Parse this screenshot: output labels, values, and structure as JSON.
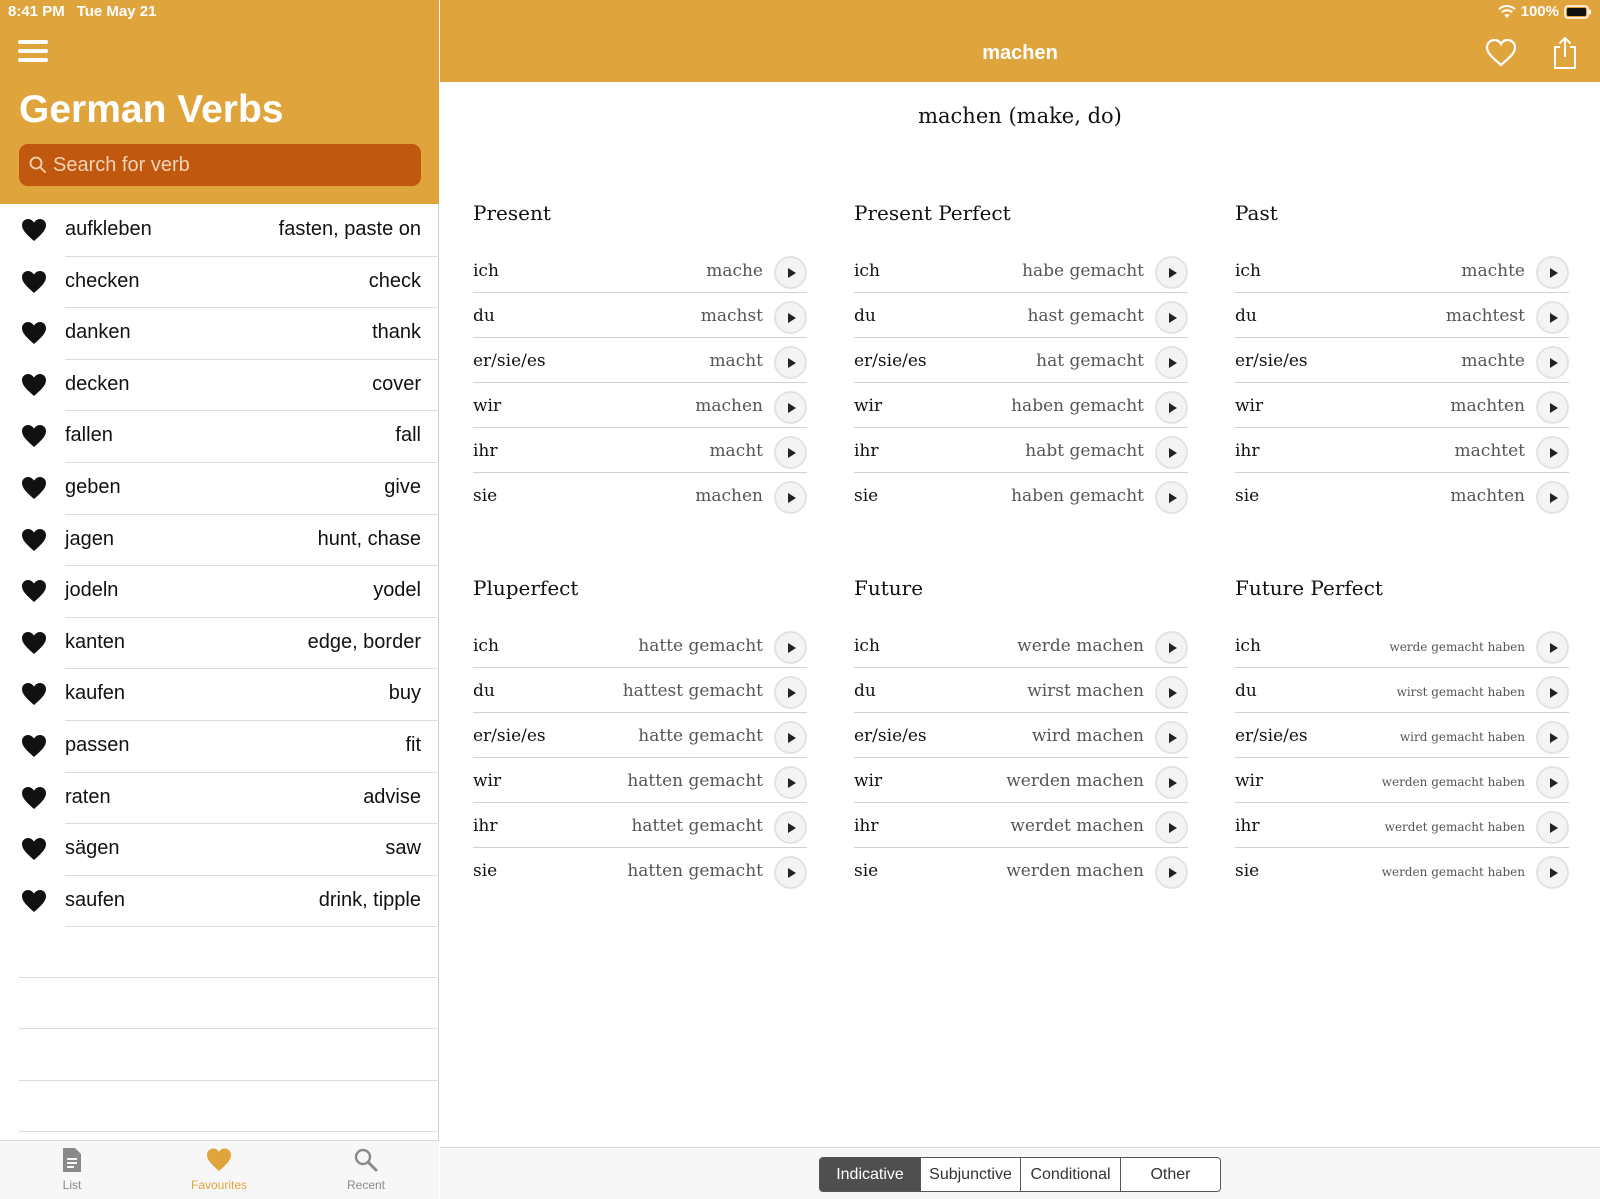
{
  "status": {
    "time": "8:41 PM",
    "date": "Tue May 21",
    "battery": "100%"
  },
  "sidebar": {
    "title": "German Verbs",
    "search_placeholder": "Search for verb",
    "verbs": [
      {
        "name": "aufkleben",
        "translation": "fasten, paste on"
      },
      {
        "name": "checken",
        "translation": "check"
      },
      {
        "name": "danken",
        "translation": "thank"
      },
      {
        "name": "decken",
        "translation": "cover"
      },
      {
        "name": "fallen",
        "translation": "fall"
      },
      {
        "name": "geben",
        "translation": "give"
      },
      {
        "name": "jagen",
        "translation": "hunt, chase"
      },
      {
        "name": "jodeln",
        "translation": "yodel"
      },
      {
        "name": "kanten",
        "translation": "edge, border"
      },
      {
        "name": "kaufen",
        "translation": "buy"
      },
      {
        "name": "passen",
        "translation": "fit"
      },
      {
        "name": "raten",
        "translation": "advise"
      },
      {
        "name": "sägen",
        "translation": "saw"
      },
      {
        "name": "saufen",
        "translation": "drink, tipple"
      }
    ],
    "tabs": [
      {
        "label": "List",
        "icon": "document-icon"
      },
      {
        "label": "Favourites",
        "icon": "heart-icon",
        "active": true
      },
      {
        "label": "Recent",
        "icon": "search-icon"
      }
    ]
  },
  "detail": {
    "nav_title": "machen",
    "heading": "machen (make, do)",
    "tenses": [
      {
        "title": "Present",
        "rows": [
          {
            "pronoun": "ich",
            "form": "mache"
          },
          {
            "pronoun": "du",
            "form": "machst"
          },
          {
            "pronoun": "er/sie/es",
            "form": "macht"
          },
          {
            "pronoun": "wir",
            "form": "machen"
          },
          {
            "pronoun": "ihr",
            "form": "macht"
          },
          {
            "pronoun": "sie",
            "form": "machen"
          }
        ]
      },
      {
        "title": "Present Perfect",
        "rows": [
          {
            "pronoun": "ich",
            "form": "habe gemacht"
          },
          {
            "pronoun": "du",
            "form": "hast gemacht"
          },
          {
            "pronoun": "er/sie/es",
            "form": "hat gemacht"
          },
          {
            "pronoun": "wir",
            "form": "haben gemacht"
          },
          {
            "pronoun": "ihr",
            "form": "habt gemacht"
          },
          {
            "pronoun": "sie",
            "form": "haben gemacht"
          }
        ]
      },
      {
        "title": "Past",
        "rows": [
          {
            "pronoun": "ich",
            "form": "machte"
          },
          {
            "pronoun": "du",
            "form": "machtest"
          },
          {
            "pronoun": "er/sie/es",
            "form": "machte"
          },
          {
            "pronoun": "wir",
            "form": "machten"
          },
          {
            "pronoun": "ihr",
            "form": "machtet"
          },
          {
            "pronoun": "sie",
            "form": "machten"
          }
        ]
      },
      {
        "title": "Pluperfect",
        "rows": [
          {
            "pronoun": "ich",
            "form": "hatte gemacht"
          },
          {
            "pronoun": "du",
            "form": "hattest gemacht"
          },
          {
            "pronoun": "er/sie/es",
            "form": "hatte gemacht"
          },
          {
            "pronoun": "wir",
            "form": "hatten gemacht"
          },
          {
            "pronoun": "ihr",
            "form": "hattet gemacht"
          },
          {
            "pronoun": "sie",
            "form": "hatten gemacht"
          }
        ]
      },
      {
        "title": "Future",
        "rows": [
          {
            "pronoun": "ich",
            "form": "werde machen"
          },
          {
            "pronoun": "du",
            "form": "wirst machen"
          },
          {
            "pronoun": "er/sie/es",
            "form": "wird machen"
          },
          {
            "pronoun": "wir",
            "form": "werden machen"
          },
          {
            "pronoun": "ihr",
            "form": "werdet machen"
          },
          {
            "pronoun": "sie",
            "form": "werden machen"
          }
        ]
      },
      {
        "title": "Future Perfect",
        "small": true,
        "rows": [
          {
            "pronoun": "ich",
            "form": "werde gemacht haben"
          },
          {
            "pronoun": "du",
            "form": "wirst gemacht haben"
          },
          {
            "pronoun": "er/sie/es",
            "form": "wird gemacht haben"
          },
          {
            "pronoun": "wir",
            "form": "werden gemacht haben"
          },
          {
            "pronoun": "ihr",
            "form": "werdet gemacht haben"
          },
          {
            "pronoun": "sie",
            "form": "werden gemacht haben"
          }
        ]
      }
    ],
    "moods": [
      {
        "label": "Indicative",
        "active": true
      },
      {
        "label": "Subjunctive"
      },
      {
        "label": "Conditional"
      },
      {
        "label": "Other"
      }
    ]
  },
  "colors": {
    "accent": "#e0a43c",
    "search_bg": "#c0580f",
    "segment_active": "#4f4f4f"
  }
}
